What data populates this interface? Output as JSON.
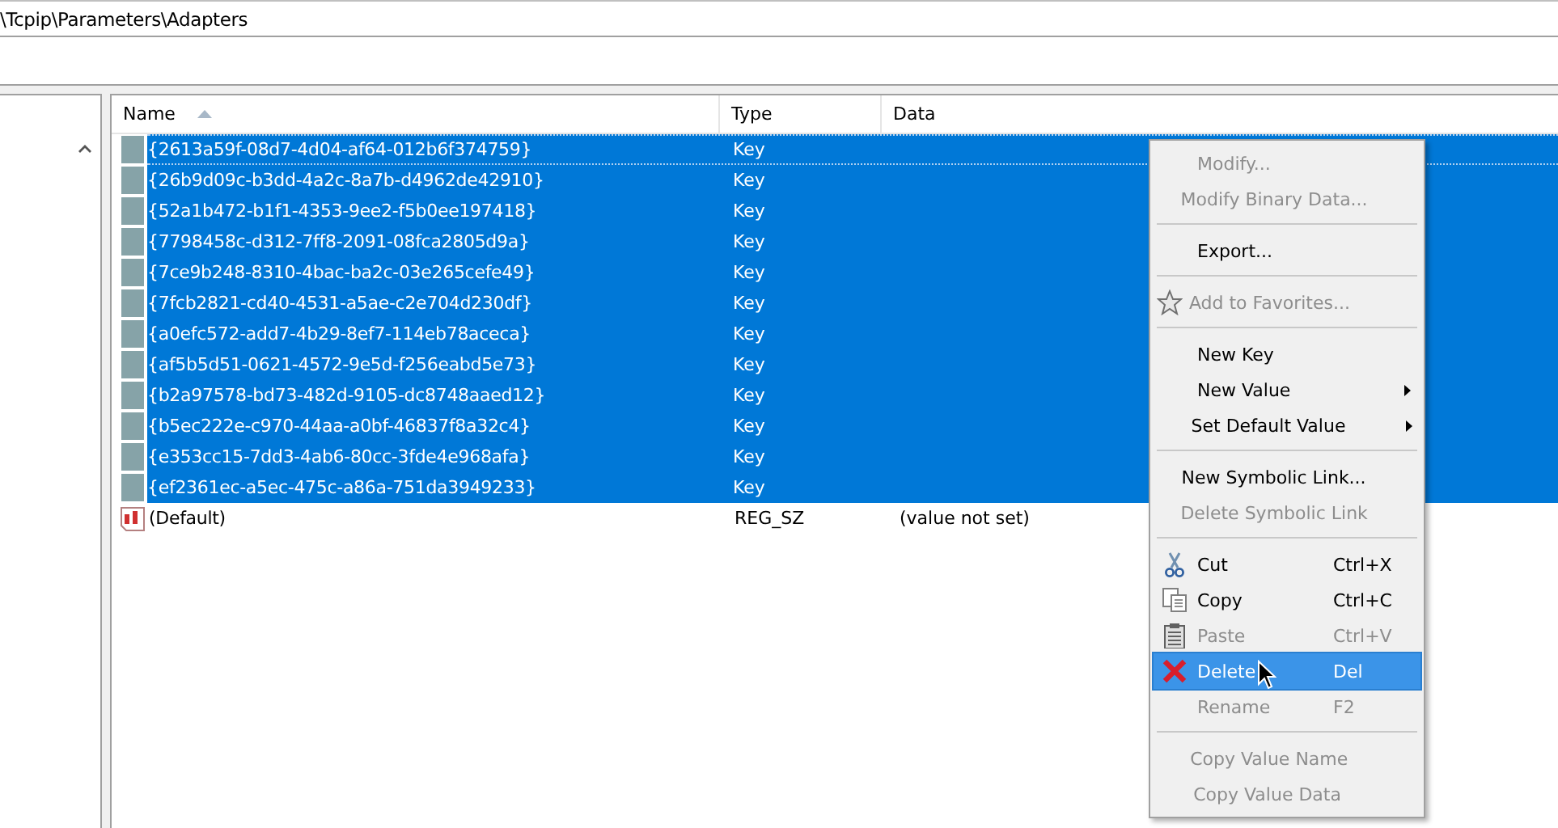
{
  "address_bar": {
    "value": "\\Tcpip\\Parameters\\Adapters"
  },
  "table": {
    "columns": [
      {
        "label": "Name",
        "sorted": true
      },
      {
        "label": "Type",
        "sorted": false
      },
      {
        "label": "Data",
        "sorted": false
      }
    ],
    "rows": [
      {
        "kind": "key",
        "name": "{2613a59f-08d7-4d04-af64-012b6f374759}",
        "type": "Key",
        "selected": true,
        "focused": true
      },
      {
        "kind": "key",
        "name": "{26b9d09c-b3dd-4a2c-8a7b-d4962de42910}",
        "type": "Key",
        "selected": true,
        "focused": false
      },
      {
        "kind": "key",
        "name": "{52a1b472-b1f1-4353-9ee2-f5b0ee197418}",
        "type": "Key",
        "selected": true,
        "focused": false
      },
      {
        "kind": "key",
        "name": "{7798458c-d312-7ff8-2091-08fca2805d9a}",
        "type": "Key",
        "selected": true,
        "focused": false
      },
      {
        "kind": "key",
        "name": "{7ce9b248-8310-4bac-ba2c-03e265cefe49}",
        "type": "Key",
        "selected": true,
        "focused": false
      },
      {
        "kind": "key",
        "name": "{7fcb2821-cd40-4531-a5ae-c2e704d230df}",
        "type": "Key",
        "selected": true,
        "focused": false
      },
      {
        "kind": "key",
        "name": "{a0efc572-add7-4b29-8ef7-114eb78aceca}",
        "type": "Key",
        "selected": true,
        "focused": false
      },
      {
        "kind": "key",
        "name": "{af5b5d51-0621-4572-9e5d-f256eabd5e73}",
        "type": "Key",
        "selected": true,
        "focused": false
      },
      {
        "kind": "key",
        "name": "{b2a97578-bd73-482d-9105-dc8748aaed12}",
        "type": "Key",
        "selected": true,
        "focused": false
      },
      {
        "kind": "key",
        "name": "{b5ec222e-c970-44aa-a0bf-46837f8a32c4}",
        "type": "Key",
        "selected": true,
        "focused": false
      },
      {
        "kind": "key",
        "name": "{e353cc15-7dd3-4ab6-80cc-3fde4e968afa}",
        "type": "Key",
        "selected": true,
        "focused": false
      },
      {
        "kind": "key",
        "name": "{ef2361ec-a5ec-475c-a86a-751da3949233}",
        "type": "Key",
        "selected": true,
        "focused": false
      },
      {
        "kind": "string",
        "name": "(Default)",
        "type": "REG_SZ",
        "data": "(value not set)",
        "selected": false,
        "focused": false
      }
    ]
  },
  "context_menu": {
    "items": [
      {
        "kind": "item",
        "label": "Modify...",
        "disabled": true,
        "selected": false
      },
      {
        "kind": "item",
        "label": "Modify Binary Data...",
        "disabled": true,
        "selected": false
      },
      {
        "kind": "separator"
      },
      {
        "kind": "item",
        "label": "Export...",
        "disabled": false,
        "selected": false
      },
      {
        "kind": "separator"
      },
      {
        "kind": "favorite",
        "label": "Add to Favorites...",
        "disabled": true,
        "selected": false
      },
      {
        "kind": "separator"
      },
      {
        "kind": "item",
        "label": "New Key",
        "disabled": false,
        "selected": false
      },
      {
        "kind": "item",
        "label": "New Value",
        "disabled": false,
        "selected": false,
        "submenu": true
      },
      {
        "kind": "item",
        "label": "Set Default Value",
        "disabled": false,
        "selected": false,
        "submenu": true
      },
      {
        "kind": "separator"
      },
      {
        "kind": "item",
        "label": "New Symbolic Link...",
        "disabled": false,
        "selected": false
      },
      {
        "kind": "item",
        "label": "Delete Symbolic Link",
        "disabled": true,
        "selected": false
      },
      {
        "kind": "separator"
      },
      {
        "kind": "cut",
        "label": "Cut",
        "shortcut": "Ctrl+X",
        "disabled": false,
        "selected": false
      },
      {
        "kind": "copy",
        "label": "Copy",
        "shortcut": "Ctrl+C",
        "disabled": false,
        "selected": false
      },
      {
        "kind": "paste",
        "label": "Paste",
        "shortcut": "Ctrl+V",
        "disabled": true,
        "selected": false
      },
      {
        "kind": "delete",
        "label": "Delete",
        "shortcut": "Del",
        "disabled": false,
        "selected": true
      },
      {
        "kind": "item",
        "label": "Rename",
        "shortcut": "F2",
        "disabled": true,
        "selected": false
      },
      {
        "kind": "separator"
      },
      {
        "kind": "item",
        "label": "Copy Value Name",
        "disabled": true,
        "selected": false
      },
      {
        "kind": "item",
        "label": "Copy Value Data",
        "disabled": true,
        "selected": false
      }
    ]
  }
}
